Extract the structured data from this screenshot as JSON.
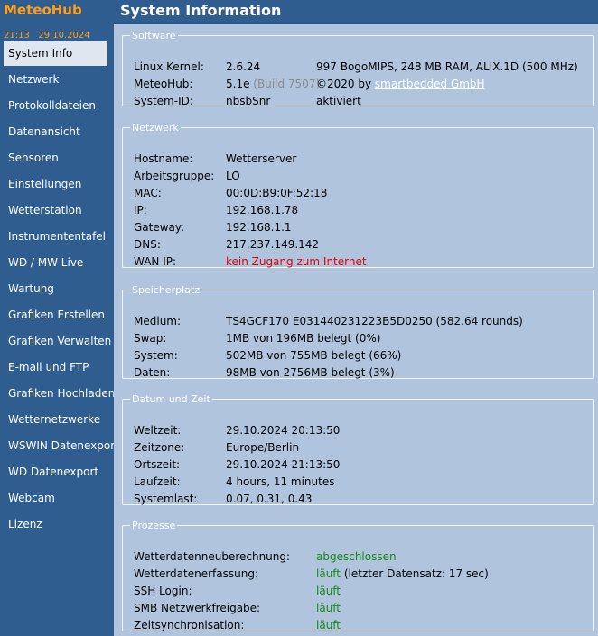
{
  "brand": "MeteoHub",
  "datetime": "21:13   29.10.2024",
  "nav": [
    "System Info",
    "Netzwerk",
    "Protokolldateien",
    "Datenansicht",
    "Sensoren",
    "Einstellungen",
    "Wetterstation",
    "Instrumententafel",
    "WD / MW Live",
    "Wartung",
    "Grafiken Erstellen",
    "Grafiken Verwalten",
    "E-mail und FTP",
    "Grafiken Hochladen",
    "Wetternetzwerke",
    "WSWIN Datenexport",
    "WD Datenexport",
    "Webcam",
    "Lizenz"
  ],
  "title": "System Information",
  "software": {
    "legend": "Software",
    "kernel_label": "Linux Kernel:",
    "kernel_value": "2.6.24",
    "kernel_extra": "997 BogoMIPS, 248 MB RAM, ALIX.1D (500 MHz)",
    "meteohub_label": "MeteoHub:",
    "meteohub_value": "5.1e",
    "meteohub_build": "(Build 7507)",
    "copyright_prefix": "©2020 by",
    "copyright_link": "smartbedded GmbH",
    "sysid_label": "System-ID:",
    "sysid_value": "nbsbSnr",
    "sysid_status": "aktiviert"
  },
  "network": {
    "legend": "Netzwerk",
    "rows": [
      {
        "label": "Hostname:",
        "value": "Wetterserver"
      },
      {
        "label": "Arbeitsgruppe:",
        "value": "LO"
      },
      {
        "label": "MAC:",
        "value": "00:0D:B9:0F:52:18"
      },
      {
        "label": "IP:",
        "value": "192.168.1.78"
      },
      {
        "label": "Gateway:",
        "value": "192.168.1.1"
      },
      {
        "label": "DNS:",
        "value": "217.237.149.142"
      },
      {
        "label": "WAN IP:",
        "value": "kein Zugang zum Internet"
      }
    ]
  },
  "storage": {
    "legend": "Speicherplatz",
    "rows": [
      {
        "label": "Medium:",
        "value": "TS4GCF170 E031440231223B5D0250 (582.64 rounds)"
      },
      {
        "label": "Swap:",
        "value": "1MB von 196MB belegt (0%)"
      },
      {
        "label": "System:",
        "value": "502MB von 755MB belegt (66%)"
      },
      {
        "label": "Daten:",
        "value": "98MB von 2756MB belegt (3%)"
      }
    ]
  },
  "datetime_section": {
    "legend": "Datum und Zeit",
    "rows": [
      {
        "label": "Weltzeit:",
        "value": "29.10.2024 20:13:50"
      },
      {
        "label": "Zeitzone:",
        "value": "Europe/Berlin"
      },
      {
        "label": "Ortszeit:",
        "value": "29.10.2024 21:13:50"
      },
      {
        "label": "Laufzeit:",
        "value": "4 hours, 11 minutes"
      },
      {
        "label": "Systemlast:",
        "value": "0.07, 0.31, 0.43"
      }
    ]
  },
  "processes": {
    "legend": "Prozesse",
    "rows": [
      {
        "label": "Wetterdatenneuberechnung:",
        "value": "abgeschlossen",
        "extra": ""
      },
      {
        "label": "Wetterdatenerfassung:",
        "value": "läuft",
        "extra": "(letzter Datensatz: 17 sec)"
      },
      {
        "label": "SSH Login:",
        "value": "läuft",
        "extra": ""
      },
      {
        "label": "SMB Netzwerkfreigabe:",
        "value": "läuft",
        "extra": ""
      },
      {
        "label": "Zeitsynchronisation:",
        "value": "läuft",
        "extra": ""
      }
    ]
  },
  "colors": {
    "sidebar": "#2f5d8f",
    "content": "#b0c4de",
    "brand": "#ff9e1b",
    "ok": "#138a13",
    "error": "#e00000"
  }
}
